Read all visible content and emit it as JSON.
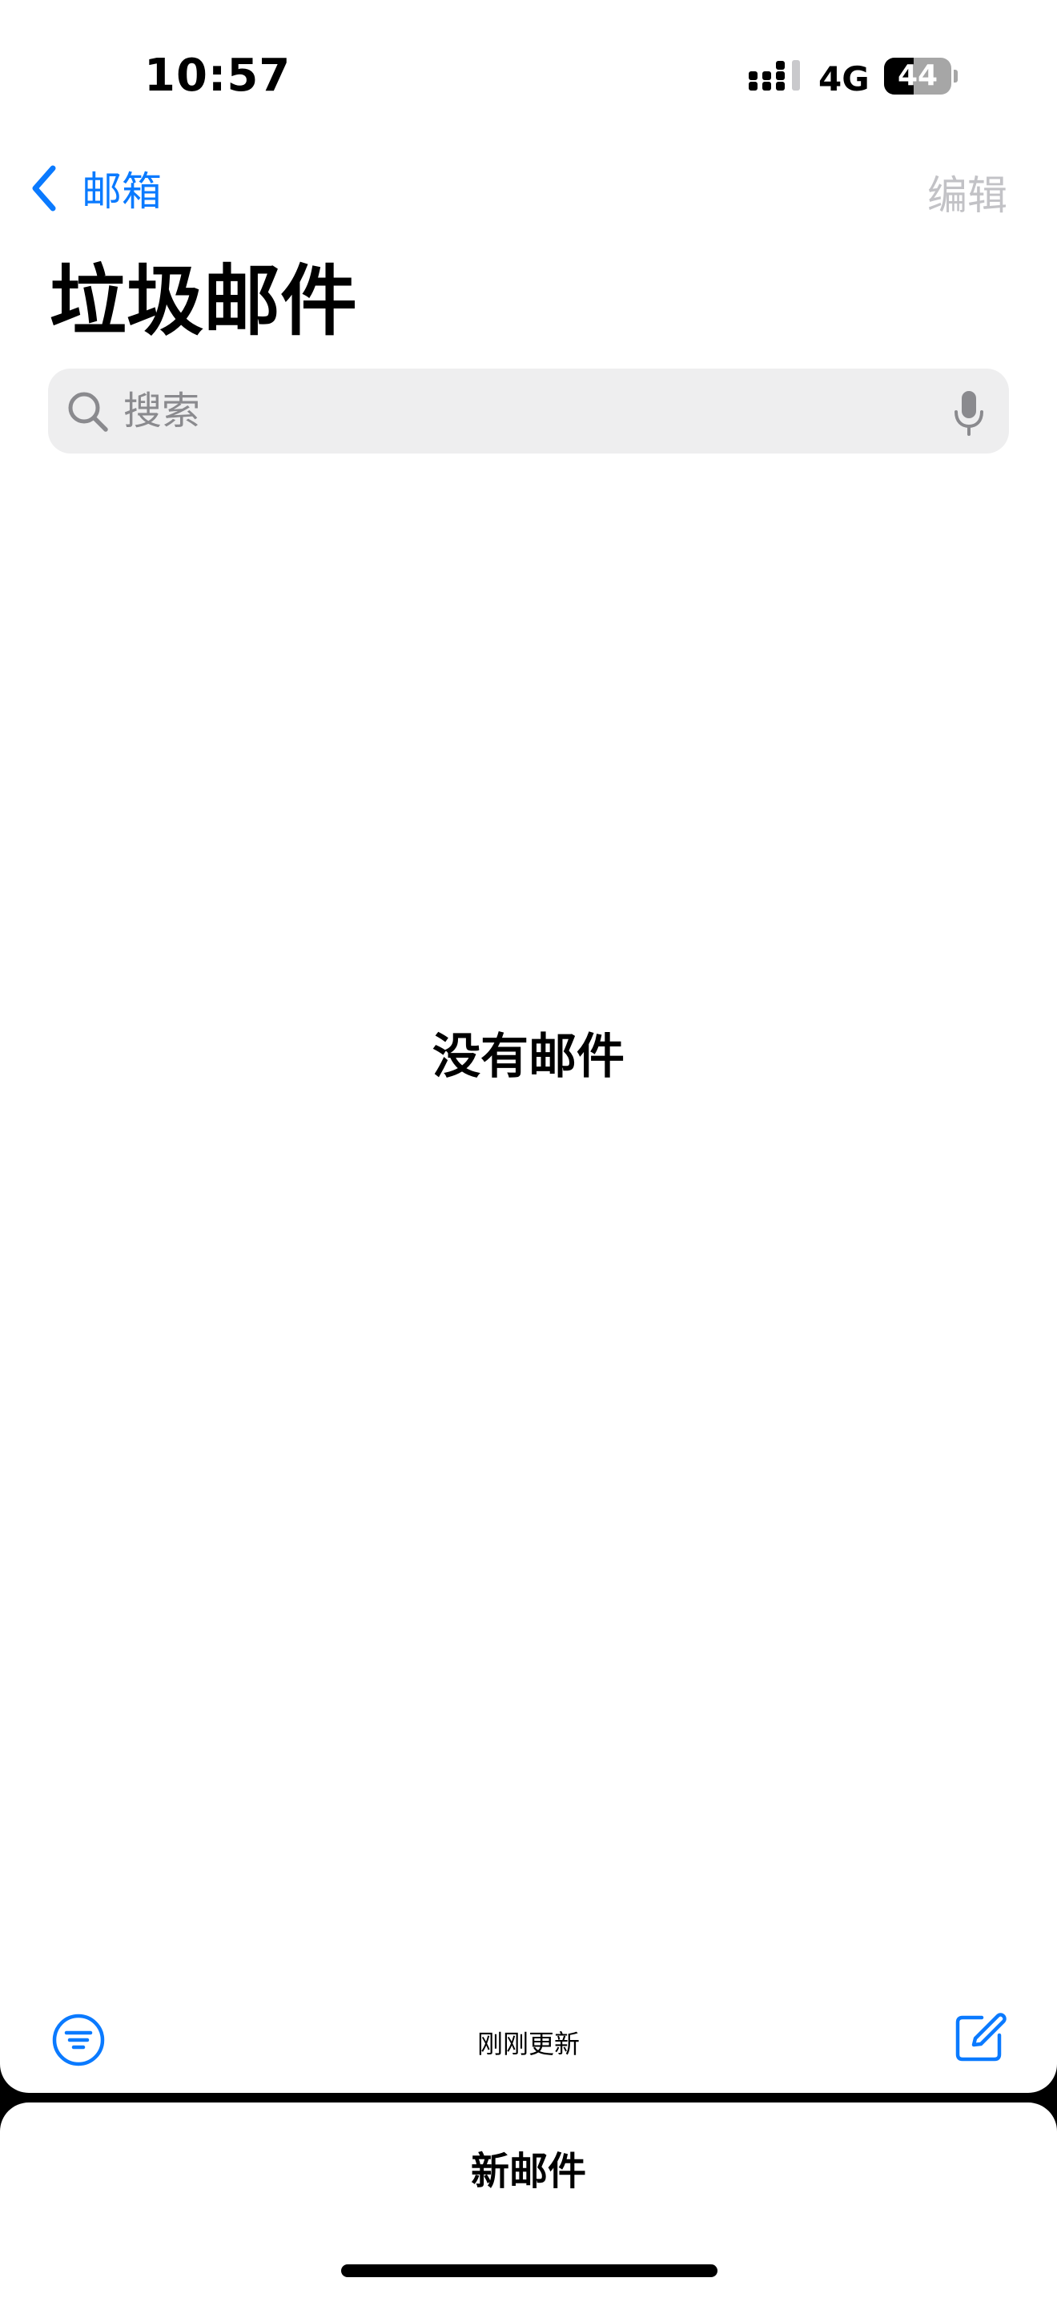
{
  "status_bar": {
    "time": "10:57",
    "network": "4G",
    "battery_level": "44",
    "battery_fraction": 0.44
  },
  "nav": {
    "back_label": "邮箱",
    "edit_label": "编辑",
    "accent_color": "#0a7aff",
    "disabled_color": "#c2c2c6"
  },
  "page": {
    "title": "垃圾邮件"
  },
  "search": {
    "placeholder": "搜索",
    "icon": "magnifying-glass",
    "mic_icon": "microphone"
  },
  "content": {
    "empty_message": "没有邮件"
  },
  "toolbar": {
    "filter_icon": "filter-circle",
    "status_text": "刚刚更新",
    "compose_icon": "square-and-pencil"
  },
  "draft_sheet": {
    "title": "新邮件"
  }
}
